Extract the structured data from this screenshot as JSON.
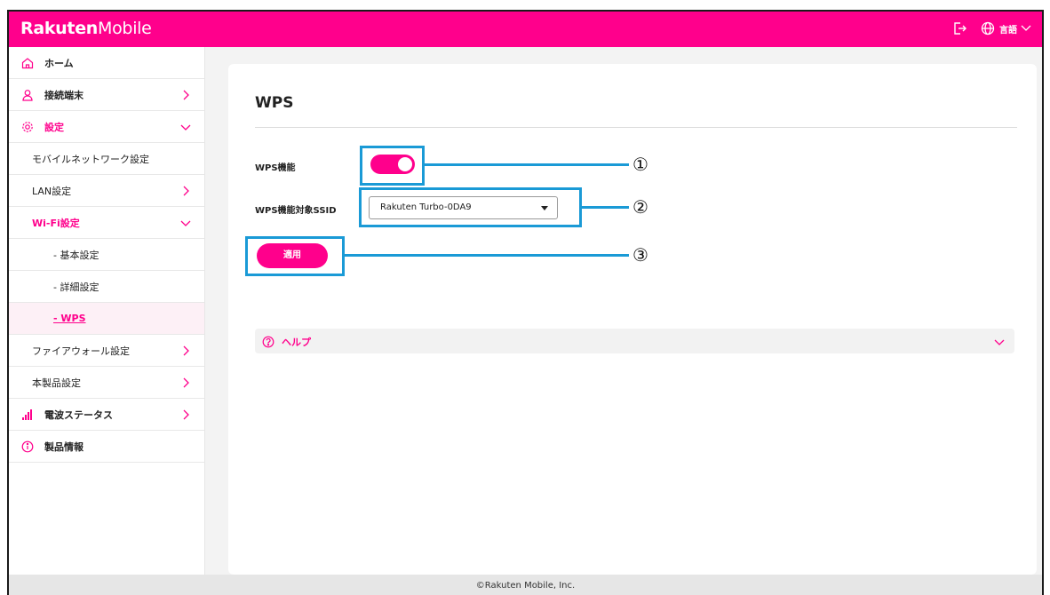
{
  "header": {
    "logo_bold": "Rakuten",
    "logo_light": "Mobile",
    "logout_icon": "logout-icon",
    "globe_icon": "globe-icon",
    "language_label": "言語"
  },
  "sidebar": {
    "items": [
      {
        "label": "ホーム",
        "icon": "home-icon"
      },
      {
        "label": "接続端末",
        "icon": "user-icon"
      },
      {
        "label": "設定",
        "icon": "gear-icon"
      },
      {
        "label": "モバイルネットワーク設定"
      },
      {
        "label": "LAN設定"
      },
      {
        "label": "Wi-Fi設定"
      },
      {
        "label": "- 基本設定"
      },
      {
        "label": "- 詳細設定"
      },
      {
        "label": "- WPS"
      },
      {
        "label": "ファイアウォール設定"
      },
      {
        "label": "本製品設定"
      },
      {
        "label": "電波ステータス",
        "icon": "signal-bars-icon"
      },
      {
        "label": "製品情報",
        "icon": "info-icon"
      }
    ]
  },
  "main": {
    "title": "WPS",
    "wps_function_label": "WPS機能",
    "wps_enabled": true,
    "ssid_label": "WPS機能対象SSID",
    "ssid_value": "Rakuten Turbo-0DA9",
    "apply_label": "適用",
    "help_label": "ヘルプ"
  },
  "callouts": [
    "①",
    "②",
    "③"
  ],
  "footer": {
    "copyright": "©Rakuten Mobile, Inc."
  },
  "colors": {
    "brand": "#ff008c",
    "highlight": "#1a9ad6"
  }
}
